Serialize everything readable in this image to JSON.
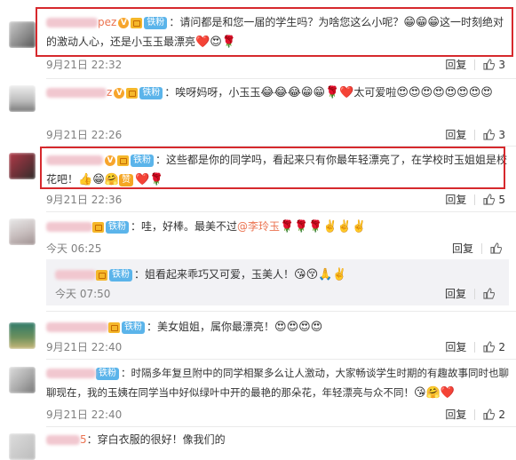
{
  "comments": [
    {
      "user_visible": "pez",
      "fan_label": "铁粉",
      "text": "：请问都是和您一届的学生吗？为啥您这么小呢？",
      "text2": "这一时刻绝对的激动人心，还是小玉玉最漂亮",
      "time": "9月21日 22:32",
      "reply": "回复",
      "likes": "3"
    },
    {
      "user_visible": "z",
      "fan_label": "铁粉",
      "text": "：唉呀妈呀，小玉玉",
      "text2": "太可爱啦",
      "time": "9月21日 22:26",
      "reply": "回复",
      "likes": "3"
    },
    {
      "fan_label": "铁粉",
      "text": "：这些都是你的同学吗，看起来只有你最年轻漂亮了，在学校时玉姐姐是校花吧！",
      "badge_char": "赞",
      "time": "9月21日 22:36",
      "reply": "回复",
      "likes": "5"
    },
    {
      "fan_label": "铁粉",
      "text": "：哇，好棒。最美不过",
      "mention": "@李玲玉",
      "time": "今天 06:25",
      "reply": "回复",
      "likes": ""
    },
    {
      "fan_label": "铁粉",
      "text": "：姐看起来乖巧又可爱，玉美人！",
      "time": "今天 07:50",
      "reply": "回复",
      "likes": ""
    },
    {
      "fan_label": "铁粉",
      "text": "：美女姐姐，属你最漂亮！",
      "time": "9月21日 22:40",
      "reply": "回复",
      "likes": "2"
    },
    {
      "fan_label": "铁粉",
      "text": "：时隔多年复旦附中的同学相聚多么让人激动，大家畅谈学生时期的有趣故事同时",
      "text2": "也聊聊现在，我的玉姨在同学当中好似绿叶中开的最艳的那朵花，年轻漂亮与众不同！",
      "time": "9月21日 22:40",
      "reply": "回复",
      "likes": "2"
    },
    {
      "user_visible": "5",
      "text": "：穿白衣服的很好！像我们的"
    }
  ]
}
